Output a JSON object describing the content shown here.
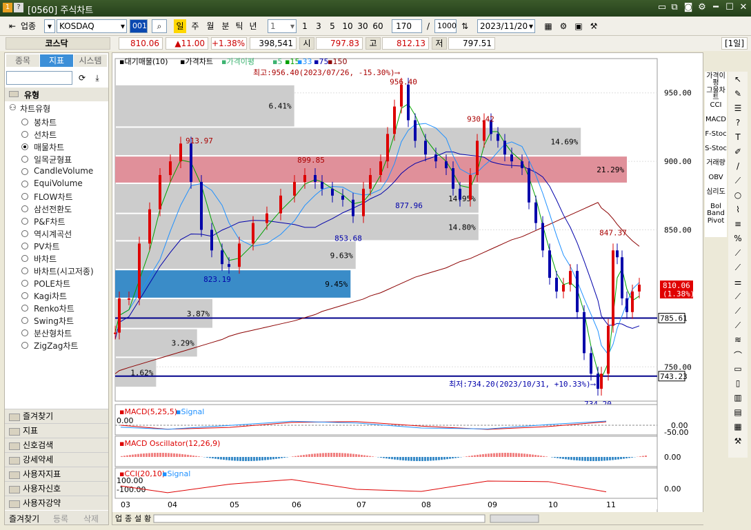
{
  "window": {
    "title": "[0560] 주식차트",
    "help": "?",
    "num": "1"
  },
  "toolbar": {
    "sector": "업종",
    "market": "KOSDAQ",
    "code": "001",
    "periods": [
      "일",
      "주",
      "월",
      "분",
      "틱",
      "년"
    ],
    "interval_value": "1",
    "n_buttons": [
      "1",
      "3",
      "5",
      "10",
      "30",
      "60"
    ],
    "count": "170",
    "total": "1000",
    "date": "2023/11/20"
  },
  "pricebar": {
    "name": "코스닥",
    "price": "810.06",
    "change": "▲11.00",
    "change_pct": "+1.38%",
    "volume": "398,541",
    "open_label": "시",
    "open": "797.83",
    "high_label": "고",
    "high": "812.13",
    "low_label": "저",
    "low": "797.51",
    "period": "[1일]"
  },
  "left": {
    "tabs": [
      "종목",
      "지표",
      "시스템"
    ],
    "group": "유형",
    "subgroup": "차트유형",
    "chart_types": [
      "봉차트",
      "선차트",
      "매물차트",
      "일목균형표",
      "CandleVolume",
      "EquiVolume",
      "FLOW차트",
      "삼선전환도",
      "P&F차트",
      "역시계곡선",
      "PV차트",
      "바차트",
      "바차트(시고저종)",
      "POLE차트",
      "Kagi차트",
      "Renko차트",
      "Swing차트",
      "분산형차트",
      "ZigZag차트"
    ],
    "selected_type": "매물차트",
    "folders": [
      "즐겨찾기",
      "지표",
      "신호검색",
      "강세약세",
      "사용자지표",
      "사용자신호",
      "사용자강약"
    ],
    "bottom_tabs": [
      "즐겨찾기",
      "등록",
      "삭제"
    ]
  },
  "chart": {
    "legend": {
      "vol": "▪대기매물(10)",
      "price": "▪가격차트",
      "ma_label": "▪가격이평",
      "ma": [
        "5",
        "15",
        "33",
        "75",
        "150"
      ],
      "ma_colors": [
        "#3cb371",
        "#00a000",
        "#1e90ff",
        "#0000aa",
        "#8b0000"
      ]
    },
    "annot": {
      "high": "최고:956.40(2023/07/26, -15.30%)⟶",
      "low": "최저:734.20(2023/10/31, +10.33%)⟶",
      "peaks": [
        "956.40",
        "930.42",
        "913.97",
        "899.85",
        "877.96",
        "853.68",
        "823.19",
        "847.37",
        "734.20"
      ]
    },
    "y_ticks": [
      "950.00",
      "900.00",
      "850.00",
      "750.00"
    ],
    "x_ticks": [
      "03",
      "04",
      "05",
      "06",
      "07",
      "08",
      "09",
      "10",
      "11"
    ],
    "price_tag": "810.06",
    "price_tag_pct": "(1.38%)",
    "line1": "785.61",
    "line2": "743.23",
    "vol_profile": [
      {
        "pct": "6.41%",
        "w": 0.35,
        "c": "gray"
      },
      {
        "pct": "14.69%",
        "w": 0.91,
        "c": "gray"
      },
      {
        "pct": "21.29%",
        "w": 1.0,
        "c": "red"
      },
      {
        "pct": "14.95%",
        "w": 0.71,
        "c": "gray"
      },
      {
        "pct": "14.80%",
        "w": 0.71,
        "c": "gray"
      },
      {
        "pct": "9.63%",
        "w": 0.47,
        "c": "gray"
      },
      {
        "pct": "9.45%",
        "w": 0.46,
        "c": "blue"
      },
      {
        "pct": "3.87%",
        "w": 0.19,
        "c": "gray"
      },
      {
        "pct": "3.29%",
        "w": 0.16,
        "c": "gray"
      },
      {
        "pct": "1.62%",
        "w": 0.08,
        "c": "gray"
      }
    ],
    "macd": {
      "label": "▪MACD(5,25,5)",
      "signal": "▪Signal",
      "v0": "0.00",
      "r1": "0.00",
      "r2": "-50.00"
    },
    "osc": {
      "label": "▪MACD Oscillator(12,26,9)",
      "r1": "0.00"
    },
    "cci": {
      "label": "▪CCI(20,10)",
      "signal": "▪Signal",
      "v1": "100.00",
      "v2": "-100.00",
      "r1": "0.00"
    }
  },
  "right": {
    "indicators": [
      "가격이평",
      "그물차트",
      "CCI",
      "MACD",
      "F-Stoc",
      "S-Stoc",
      "거래량",
      "OBV",
      "심리도",
      "Bol Band",
      "Pivot"
    ]
  },
  "bottom": {
    "buttons": [
      "업",
      "종",
      "설",
      "황"
    ]
  }
}
